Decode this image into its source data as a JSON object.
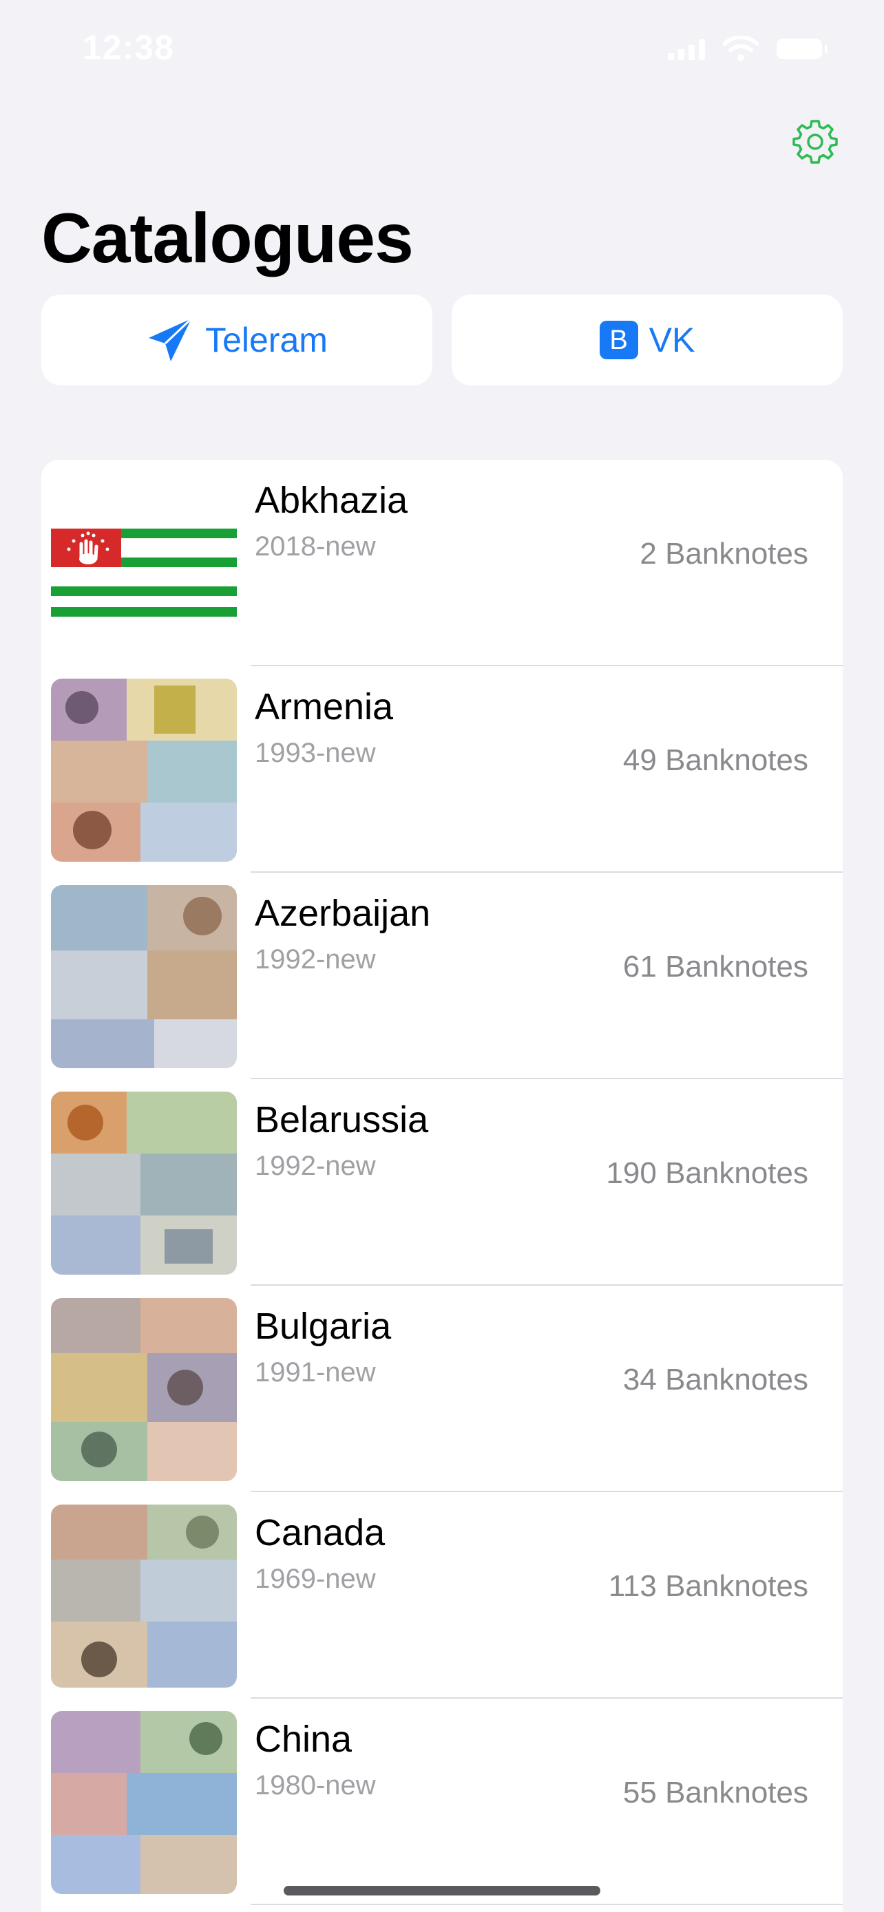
{
  "status_bar": {
    "time": "12:38"
  },
  "header": {
    "title": "Catalogues"
  },
  "links": [
    {
      "label": "Teleram",
      "icon": "telegram-plane-icon"
    },
    {
      "label": "VK",
      "icon": "vk-logo-icon",
      "badge": "B"
    }
  ],
  "catalogues": [
    {
      "name": "Abkhazia",
      "years": "2018-new",
      "count": "2 Banknotes",
      "thumb": "abkhazia-flag"
    },
    {
      "name": "Armenia",
      "years": "1993-new",
      "count": "49 Banknotes",
      "thumb": "banknote-collage"
    },
    {
      "name": "Azerbaijan",
      "years": "1992-new",
      "count": "61 Banknotes",
      "thumb": "banknote-collage"
    },
    {
      "name": "Belarussia",
      "years": "1992-new",
      "count": "190 Banknotes",
      "thumb": "banknote-collage"
    },
    {
      "name": "Bulgaria",
      "years": "1991-new",
      "count": "34 Banknotes",
      "thumb": "banknote-collage"
    },
    {
      "name": "Canada",
      "years": "1969-new",
      "count": "113 Banknotes",
      "thumb": "banknote-collage"
    },
    {
      "name": "China",
      "years": "1980-new",
      "count": "55 Banknotes",
      "thumb": "banknote-collage"
    }
  ],
  "colors": {
    "accent": "#1779f5",
    "settings": "#2dbb55",
    "background": "#f2f2f7"
  }
}
